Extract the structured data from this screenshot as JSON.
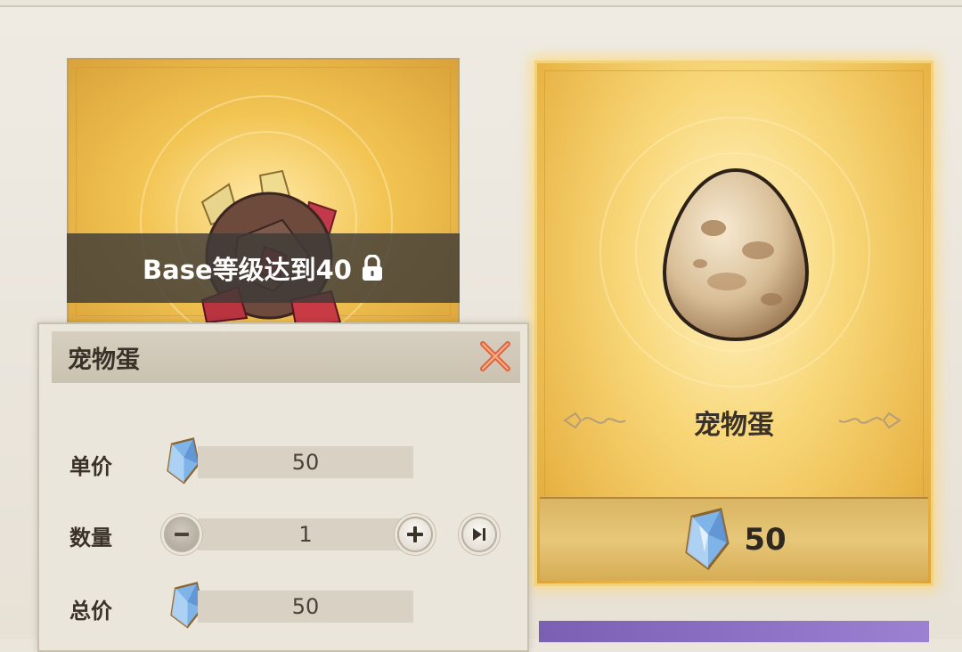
{
  "locked_card": {
    "lock_text": "Base等级达到40",
    "icon": "lock-icon"
  },
  "featured_card": {
    "item_name": "宠物蛋",
    "price": "50",
    "currency_icon": "crystal-gem-icon",
    "item_icon": "pet-egg-icon"
  },
  "purchase_dialog": {
    "title": "宠物蛋",
    "unit_price_label": "单价",
    "unit_price_value": "50",
    "quantity_label": "数量",
    "quantity_value": "1",
    "total_label": "总价",
    "total_value": "50",
    "buttons": {
      "decrease": "minus-icon",
      "increase": "plus-icon",
      "max": "max-skip-icon",
      "close": "close-icon"
    }
  },
  "colors": {
    "gold": "#f2c452",
    "dialog_bg": "#ebe6dc",
    "text_dark": "#3a3128",
    "close_accent": "#e0633a",
    "purple_tier": "#8a6cc4"
  }
}
